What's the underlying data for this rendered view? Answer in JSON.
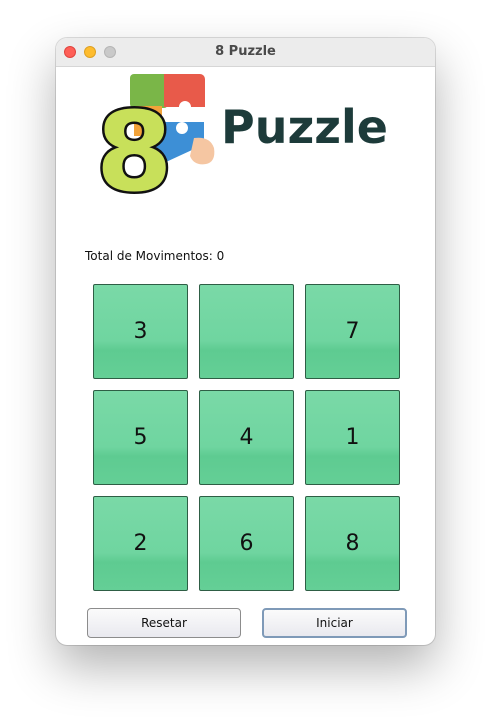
{
  "window": {
    "title": "8 Puzzle"
  },
  "logo": {
    "text": "Puzzle",
    "digit": "8",
    "icon": "puzzle-pieces-logo"
  },
  "status": {
    "moves_text": "Total de Movimentos: 0",
    "moves": 0
  },
  "board": {
    "tiles": [
      "3",
      "",
      "7",
      "5",
      "4",
      "1",
      "2",
      "6",
      "8"
    ]
  },
  "buttons": {
    "reset_label": "Resetar",
    "start_label": "Iniciar"
  },
  "colors": {
    "tile_green": "#6fd5a0",
    "logo_text": "#1d3b3a",
    "close": "#fe5f57",
    "minimize": "#febc2e",
    "zoom_disabled": "#c9c9c9"
  }
}
